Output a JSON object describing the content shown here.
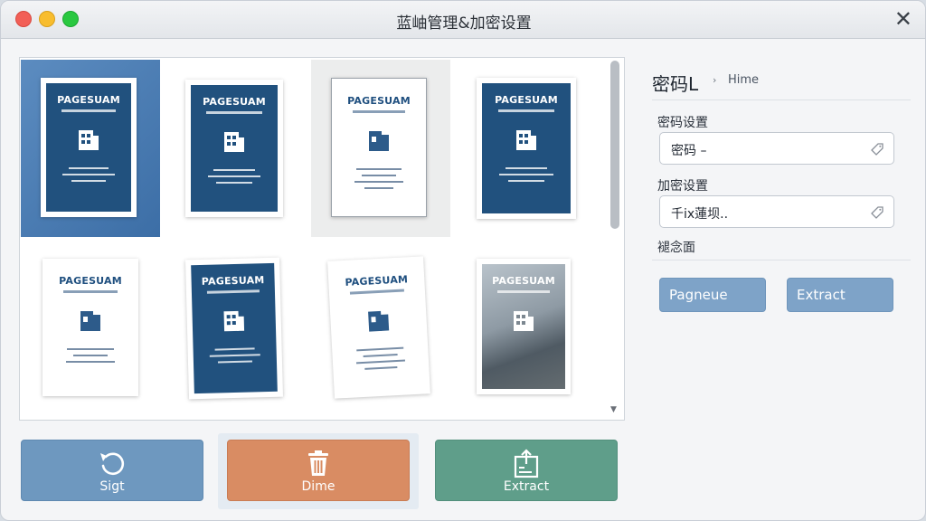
{
  "window": {
    "title": "蓝岫管理&加密设置"
  },
  "documents": [
    {
      "title": "PAGESUAM",
      "style": "blue",
      "selected": true
    },
    {
      "title": "PAGESUAM",
      "style": "blue"
    },
    {
      "title": "PAGESUAM",
      "style": "white",
      "hover": true
    },
    {
      "title": "PAGESUAM",
      "style": "blue"
    },
    {
      "title": "PAGESUAM",
      "style": "white"
    },
    {
      "title": "PAGESUAM",
      "style": "blue"
    },
    {
      "title": "PAGESUAM",
      "style": "white"
    },
    {
      "title": "PAGESUAM",
      "style": "photo"
    }
  ],
  "sidebar": {
    "breadcrumb_main": "密码L",
    "breadcrumb_sub": "Hime",
    "password_label": "密码设置",
    "password_value": "密码 –",
    "encryption_label": "加密设置",
    "encryption_value": "千ix蓮坝..",
    "note_label": "褪念面",
    "buttons": {
      "left": "Pagneue",
      "right": "Extract"
    }
  },
  "actions": {
    "sight": "Sigt",
    "dime": "Dime",
    "extract": "Extract"
  },
  "colors": {
    "accent_blue": "#6e98bf",
    "accent_orange": "#d98c63",
    "accent_teal": "#5f9e8a",
    "doc_blue": "#21517e"
  }
}
